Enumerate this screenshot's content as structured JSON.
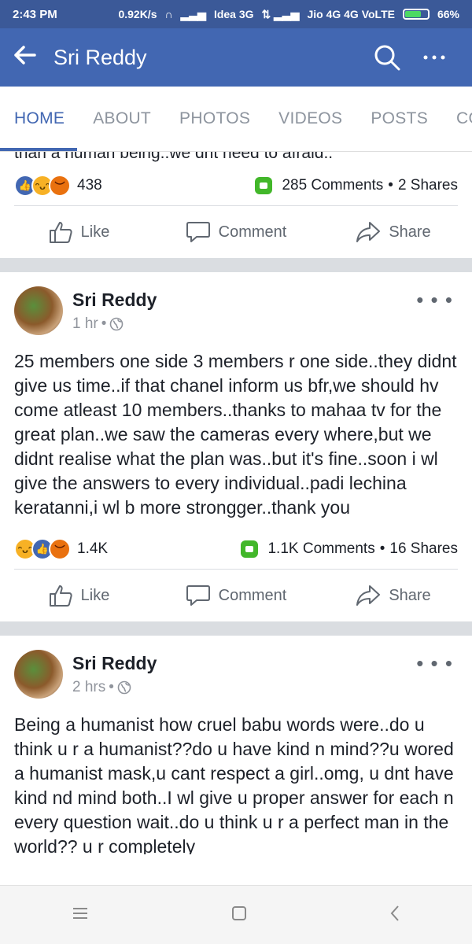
{
  "status_bar": {
    "time": "2:43 PM",
    "network_speed": "0.92K/s",
    "carrier1": "Idea 3G",
    "carrier2": "Jio 4G 4G VoLTE",
    "battery": "66%",
    "battery_level": 0.66
  },
  "app_bar": {
    "title": "Sri Reddy",
    "back_icon": "back-arrow-icon",
    "search_icon": "search-icon",
    "more_icon": "more-icon"
  },
  "tabs": [
    "HOME",
    "ABOUT",
    "PHOTOS",
    "VIDEOS",
    "POSTS",
    "COM"
  ],
  "active_tab": "HOME",
  "previous_post": {
    "cut_text": "than a human being..we dnt need to afraid..",
    "reaction_count": "438",
    "comments": "285 Comments",
    "shares": "2 Shares"
  },
  "actions": {
    "like": "Like",
    "comment": "Comment",
    "share": "Share"
  },
  "posts": [
    {
      "author": "Sri Reddy",
      "time": "1 hr",
      "text": "25 members one side 3 members r one side..they didnt give us time..if that chanel inform us bfr,we should hv come atleast 10 members..thanks to mahaa tv for the great plan..we saw the cameras every where,but we didnt realise what the plan was..but it's fine..soon i wl give the answers to every individual..padi lechina keratanni,i wl b more strongger..thank you",
      "reaction_count": "1.4K",
      "comments": "1.1K Comments",
      "shares": "16 Shares"
    },
    {
      "author": "Sri Reddy",
      "time": "2 hrs",
      "text": "Being a humanist how cruel babu words were..do u think u r a humanist??do u have kind n mind??u wored a humanist  mask,u cant respect a girl..omg, u dnt have kind nd mind both..I wl give u proper answer for each n  every question wait..do u think u r a perfect man in the world?? u r completely"
    }
  ],
  "colors": {
    "brand": "#4267b2",
    "status_bar": "#3b5998",
    "comment_icon": "#42b72a"
  }
}
